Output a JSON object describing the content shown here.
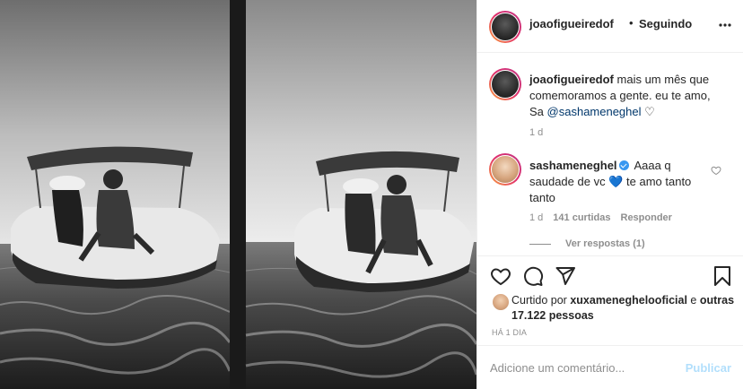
{
  "header": {
    "username": "joaofigueiredof",
    "separator": "•",
    "follow_status": "Seguindo",
    "more_icon": "more-horizontal-icon"
  },
  "caption": {
    "username": "joaofigueiredof",
    "text": "mais um mês que comemoramos a gente. eu te amo, Sa",
    "mention": "@sashameneghel",
    "emoji": "♡",
    "time": "1 d"
  },
  "comment": {
    "username": "sashameneghel",
    "verified": true,
    "text_before": "Aaaa q saudade de vc",
    "emoji": "💙",
    "text_after": "te amo tanto tanto",
    "time": "1 d",
    "likes": "141 curtidas",
    "reply_label": "Responder",
    "view_replies": "Ver respostas (1)"
  },
  "actions": {
    "like_icon": "heart-icon",
    "comment_icon": "comment-icon",
    "share_icon": "share-icon",
    "save_icon": "bookmark-icon"
  },
  "likes": {
    "prefix": "Curtido por",
    "user": "xuxameneghelooficial",
    "middle": "e",
    "others": "outras 17.122 pessoas"
  },
  "post_date": "HÁ 1 DIA",
  "add_comment": {
    "placeholder": "Adicione um comentário...",
    "publish_label": "Publicar"
  },
  "colors": {
    "link": "#00376b",
    "muted": "#8e8e8e",
    "verified": "#3897f0",
    "publish_disabled": "#b2dffc"
  }
}
